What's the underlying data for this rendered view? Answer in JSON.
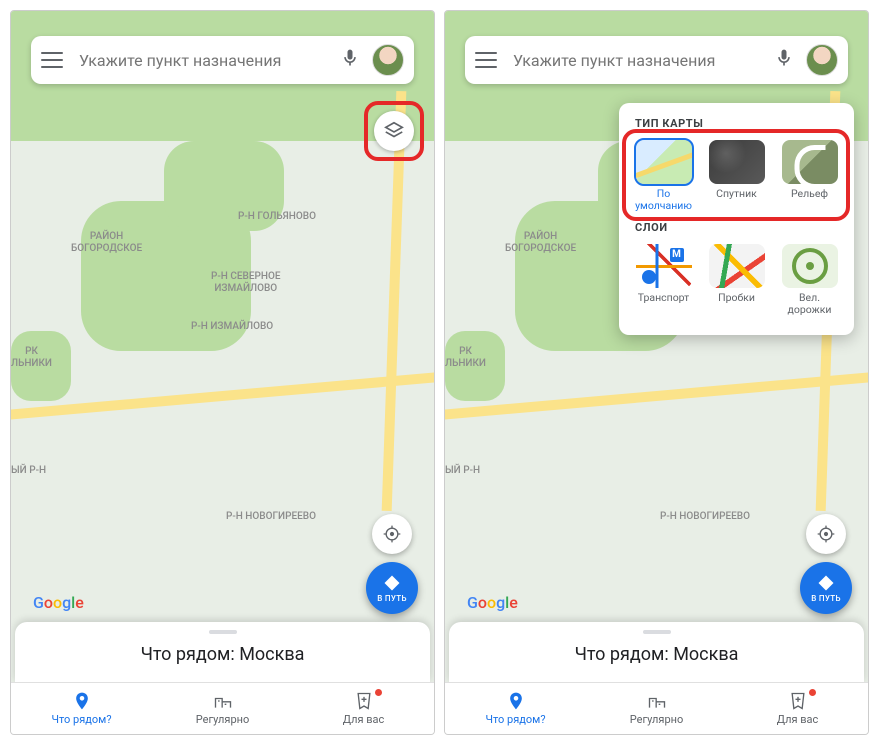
{
  "search": {
    "placeholder": "Укажите пункт назначения"
  },
  "go_button": {
    "label": "В ПУТЬ"
  },
  "bottom_sheet": {
    "title": "Что рядом: Москва"
  },
  "bottom_nav": {
    "items": [
      {
        "label": "Что рядом?",
        "active": true
      },
      {
        "label": "Регулярно",
        "active": false
      },
      {
        "label": "Для вас",
        "active": false,
        "badge": true
      }
    ]
  },
  "google_logo": "Google",
  "map_labels": {
    "bogorodskoe": "РАЙОН\nБОГОРОДСКОЕ",
    "golyanovo": "Р-Н ГОЛЬЯНОВО",
    "sev_izm": "Р-Н СЕВЕРНОЕ\nИЗМАЙЛОВО",
    "izmailovo": "Р-Н ИЗМАЙЛОВО",
    "lniki": "РК\nЛЬНИКИ",
    "yirn": "ЫЙ Р-Н",
    "novogireevo": "Р-Н НОВОГИРЕЕВО"
  },
  "layers_panel": {
    "type_heading": "ТИП КАРТЫ",
    "layer_heading": "СЛОИ",
    "map_types": [
      {
        "label": "По\nумолчанию",
        "selected": true,
        "thumb": "default"
      },
      {
        "label": "Спутник",
        "selected": false,
        "thumb": "sat"
      },
      {
        "label": "Рельеф",
        "selected": false,
        "thumb": "terrain"
      }
    ],
    "layers": [
      {
        "label": "Транспорт",
        "thumb": "transport"
      },
      {
        "label": "Пробки",
        "thumb": "traffic"
      },
      {
        "label": "Вел.\nдорожки",
        "thumb": "bike"
      }
    ]
  }
}
